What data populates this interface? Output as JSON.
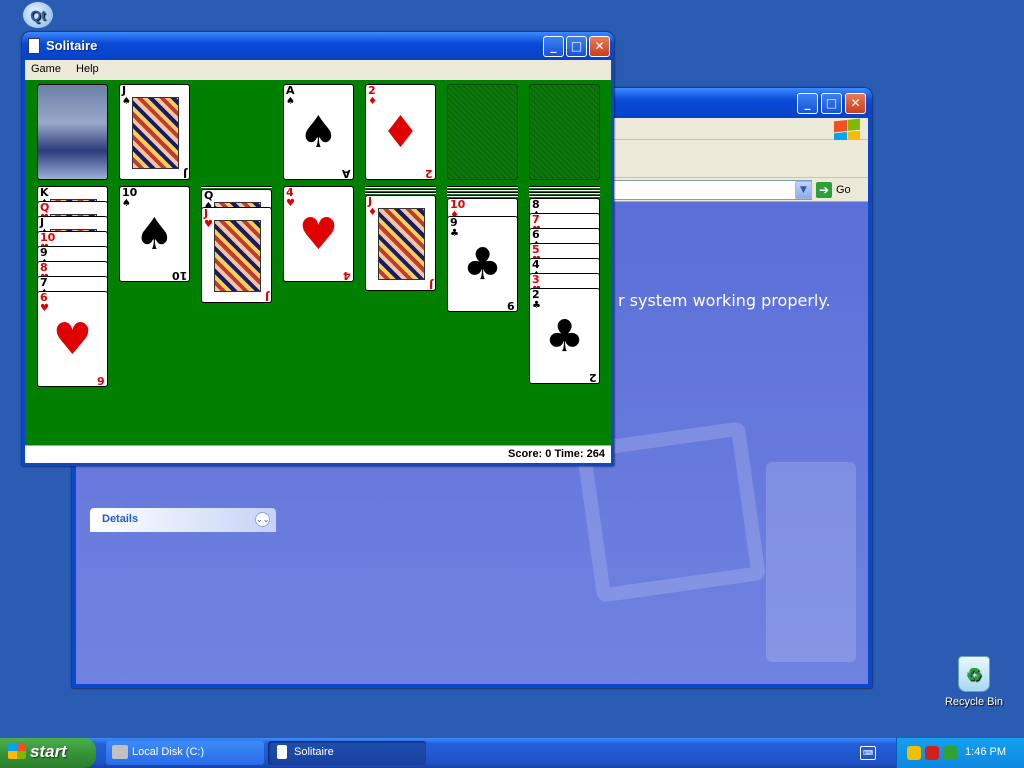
{
  "desktop": {
    "icons": [
      {
        "label": "Recycle Bin",
        "icon": "recycle-bin-icon"
      }
    ],
    "qt_icon_text": "Qt"
  },
  "explorer": {
    "visible_text": "r system working properly.",
    "details_label": "Details",
    "go_label": "Go"
  },
  "solitaire": {
    "title": "Solitaire",
    "menu": [
      "Game",
      "Help"
    ],
    "status": "Score: 0 Time: 264",
    "stock_back": "astronaut",
    "waste": [
      {
        "rank": "J",
        "suit": "♠",
        "color": "blk"
      }
    ],
    "foundations": [
      {
        "rank": "A",
        "suit": "♠",
        "color": "blk"
      },
      {
        "rank": "2",
        "suit": "♦",
        "color": "red"
      },
      null,
      null
    ],
    "tableau": [
      {
        "facedown": 0,
        "cards": [
          {
            "rank": "K",
            "suit": "♠",
            "color": "blk"
          },
          {
            "rank": "Q",
            "suit": "♥",
            "color": "red"
          },
          {
            "rank": "J",
            "suit": "♠",
            "color": "blk"
          },
          {
            "rank": "10",
            "suit": "♥",
            "color": "red"
          },
          {
            "rank": "9",
            "suit": "♠",
            "color": "blk"
          },
          {
            "rank": "8",
            "suit": "♥",
            "color": "red"
          },
          {
            "rank": "7",
            "suit": "♠",
            "color": "blk"
          },
          {
            "rank": "6",
            "suit": "♥",
            "color": "red"
          }
        ]
      },
      {
        "facedown": 0,
        "cards": [
          {
            "rank": "10",
            "suit": "♠",
            "color": "blk"
          }
        ]
      },
      {
        "facedown": 1,
        "cards": [
          {
            "rank": "Q",
            "suit": "♠",
            "color": "blk"
          },
          {
            "rank": "J",
            "suit": "♥",
            "color": "red"
          }
        ]
      },
      {
        "facedown": 0,
        "cards": [
          {
            "rank": "4",
            "suit": "♥",
            "color": "red"
          }
        ]
      },
      {
        "facedown": 3,
        "cards": [
          {
            "rank": "J",
            "suit": "♦",
            "color": "red"
          }
        ]
      },
      {
        "facedown": 4,
        "cards": [
          {
            "rank": "10",
            "suit": "♦",
            "color": "red"
          },
          {
            "rank": "9",
            "suit": "♣",
            "color": "blk"
          }
        ]
      },
      {
        "facedown": 4,
        "cards": [
          {
            "rank": "8",
            "suit": "♠",
            "color": "blk"
          },
          {
            "rank": "7",
            "suit": "♥",
            "color": "red"
          },
          {
            "rank": "6",
            "suit": "♠",
            "color": "blk"
          },
          {
            "rank": "5",
            "suit": "♥",
            "color": "red"
          },
          {
            "rank": "4",
            "suit": "♠",
            "color": "blk"
          },
          {
            "rank": "3",
            "suit": "♥",
            "color": "red"
          },
          {
            "rank": "2",
            "suit": "♣",
            "color": "blk"
          }
        ]
      }
    ]
  },
  "taskbar": {
    "start_label": "start",
    "tasks": [
      {
        "label": "Local Disk (C:)",
        "icon": "drive-icon"
      },
      {
        "label": "Solitaire",
        "icon": "solitaire-icon"
      }
    ],
    "clock": "1:46 PM"
  },
  "colors": {
    "felt": "#007f00",
    "desktop": "#2a5cb4",
    "titlebar": "#0a4ad8"
  }
}
